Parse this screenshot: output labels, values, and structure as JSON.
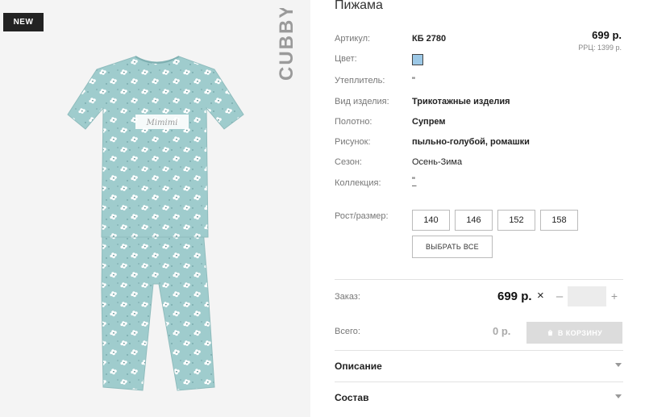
{
  "gallery": {
    "badge": "NEW",
    "brand": "CUBBY",
    "print_text": "Mimimi"
  },
  "product": {
    "title": "Пижама",
    "price": "699 р.",
    "rrp": "РРЦ: 1399 р.",
    "color_hex": "#9cc8e6",
    "attributes": [
      {
        "label": "Артикул:",
        "value": "КБ 2780"
      },
      {
        "label": "Цвет:",
        "value": ""
      },
      {
        "label": "Утеплитель:",
        "value": "\""
      },
      {
        "label": "Вид изделия:",
        "value": "Трикотажные изделия"
      },
      {
        "label": "Полотно:",
        "value": "Супрем"
      },
      {
        "label": "Рисунок:",
        "value": "пыльно-голубой, ромашки"
      },
      {
        "label": "Сезон:",
        "value": "Осень-Зима"
      },
      {
        "label": "Коллекция:",
        "value": "\""
      }
    ],
    "collection_extra": "–",
    "size_label": "Рост/размер:",
    "sizes": [
      "140",
      "146",
      "152",
      "158"
    ],
    "select_all": "ВЫБРАТЬ ВСЕ"
  },
  "order": {
    "label": "Заказ:",
    "price": "699 р.",
    "times": "×",
    "minus": "–",
    "qty": "",
    "plus": "+"
  },
  "total": {
    "label": "Всего:",
    "value": "0 р.",
    "cart_button": "В КОРЗИНУ"
  },
  "accordion": [
    {
      "title": "Описание"
    },
    {
      "title": "Состав"
    }
  ]
}
